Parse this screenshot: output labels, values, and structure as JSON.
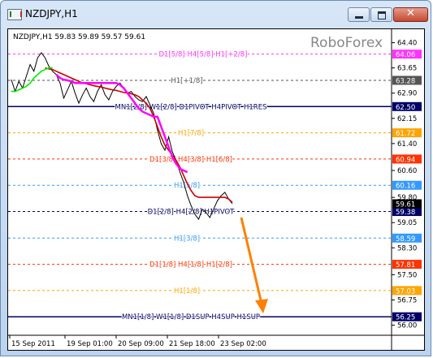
{
  "window": {
    "title": "NZDJPY,H1",
    "close_glyph": "✕",
    "icons": [
      "app-chart-icon",
      "minimize-icon",
      "maximize-icon",
      "close-icon"
    ]
  },
  "chart": {
    "info": "NZDJPY,H1  59.83 59.89 59.57 59.61",
    "watermark": "RoboForex"
  },
  "chart_data": {
    "type": "line",
    "symbol": "NZDJPY",
    "timeframe": "H1",
    "ohlc": {
      "open": 59.83,
      "high": 59.89,
      "low": 59.57,
      "close": 59.61
    },
    "ylim": [
      55.7,
      64.8
    ],
    "x_ticks": [
      "15 Sep 2011",
      "19 Sep 01:00",
      "20 Sep 09:00",
      "21 Sep 18:00",
      "23 Sep 02:00"
    ],
    "y_ticks": [
      "64.40",
      "63.65",
      "62.90",
      "62.15",
      "61.40",
      "60.60",
      "59.80",
      "59.05",
      "58.30",
      "57.50",
      "56.75",
      "56.00"
    ],
    "levels": [
      {
        "value": 64.06,
        "tag": "64.06",
        "label": "D1[5/8] H4[5/8] H1[+2/8]",
        "color": "#ff33ff",
        "tag_text": "#ffffff",
        "style": "dashed"
      },
      {
        "value": 63.28,
        "tag": "63.28",
        "label": "H1[+1/8]",
        "color": "#555555",
        "tag_text": "#ffffff",
        "style": "dashed"
      },
      {
        "value": 62.5,
        "tag": "62.50",
        "label": "MN1[2/8] W1[2/8] D1PIVOT H4PIVOT H1RES",
        "color": "#000066",
        "tag_text": "#ffffff",
        "style": "solid"
      },
      {
        "value": 61.72,
        "tag": "61.72",
        "label": "H1[7/8]",
        "color": "#ffa500",
        "tag_text": "#ffffff",
        "style": "dashed"
      },
      {
        "value": 60.94,
        "tag": "60.94",
        "label": "D1[3/8] H4[3/8] H1[6/8]",
        "color": "#ff3300",
        "tag_text": "#ffffff",
        "style": "dashed"
      },
      {
        "value": 60.16,
        "tag": "60.16",
        "label": "H1[5/8]",
        "color": "#3399ff",
        "tag_text": "#ffffff",
        "style": "dashed"
      },
      {
        "value": 59.38,
        "tag": "59.38",
        "label": "D1[2/8] H4[2/8] H1PIVOT",
        "color": "#000066",
        "tag_text": "#ffffff",
        "style": "dashed"
      },
      {
        "value": 58.59,
        "tag": "58.59",
        "label": "H1[3/8]",
        "color": "#3399ff",
        "tag_text": "#ffffff",
        "style": "dashed"
      },
      {
        "value": 57.81,
        "tag": "57.81",
        "label": "D1[1/8] H4[1/8] H1[2/8]",
        "color": "#ff3300",
        "tag_text": "#ffffff",
        "style": "dashed"
      },
      {
        "value": 57.03,
        "tag": "57.03",
        "label": "H1[1/8]",
        "color": "#ffa500",
        "tag_text": "#ffffff",
        "style": "dashed"
      },
      {
        "value": 56.25,
        "tag": "56.25",
        "label": "MN1[1/8] W1[1/8] D1SUP H4SUP H1SUP",
        "color": "#000066",
        "tag_text": "#ffffff",
        "style": "solid"
      }
    ],
    "current_price_tags": [
      {
        "value": 59.61,
        "tag": "59.61",
        "color": "#000000",
        "tag_text": "#ffffff"
      }
    ],
    "series": [
      {
        "color": "#000000",
        "values": [
          63.3,
          62.95,
          63.25,
          63.05,
          63.4,
          63.75,
          63.55,
          63.95,
          64.1,
          63.95,
          63.7,
          63.55,
          63.45,
          63.2,
          62.75,
          63.0,
          63.25,
          62.9,
          62.6,
          62.85,
          63.05,
          62.8,
          62.65,
          62.95,
          63.15,
          62.85,
          62.7,
          62.95,
          63.1,
          63.2,
          63.05,
          62.9,
          62.95,
          62.8,
          62.7,
          62.65,
          62.8,
          62.55,
          62.3,
          61.8,
          61.4,
          61.2,
          61.6,
          61.15,
          60.9,
          60.55,
          60.25,
          59.85,
          59.55,
          59.3,
          59.15,
          59.45,
          59.35,
          59.2,
          59.45,
          59.7,
          59.85,
          59.95,
          59.75,
          59.61
        ]
      },
      {
        "color": "#cc0000",
        "values": [
          null,
          null,
          null,
          null,
          null,
          null,
          null,
          null,
          null,
          63.65,
          63.62,
          63.6,
          63.55,
          63.5,
          63.45,
          63.4,
          63.35,
          63.3,
          63.25,
          63.2,
          63.18,
          63.15,
          63.12,
          63.1,
          63.08,
          63.05,
          63.02,
          63.0,
          62.98,
          62.95,
          62.92,
          62.9,
          62.88,
          62.85,
          62.8,
          62.7,
          62.6,
          62.45,
          62.2,
          61.9,
          61.6,
          61.35,
          61.2,
          61.05,
          60.9,
          60.7,
          60.45,
          60.2,
          60.0,
          59.85,
          59.8,
          59.8,
          59.8,
          59.8,
          59.8,
          59.8,
          59.8,
          59.8,
          59.75,
          59.65
        ]
      },
      {
        "color": "#00ee00",
        "values": [
          62.95,
          62.95,
          63.0,
          63.05,
          63.1,
          63.2,
          63.35,
          63.45,
          63.55,
          63.6,
          63.65,
          63.65,
          null,
          null,
          null,
          null,
          null,
          null,
          null,
          null,
          null,
          null,
          null,
          null,
          null,
          null,
          null,
          null,
          null,
          null,
          null,
          null,
          null,
          null,
          null,
          null,
          null,
          null,
          null,
          null,
          null,
          null,
          null,
          null,
          null,
          null,
          null,
          null,
          null,
          null,
          null,
          null,
          null,
          null,
          null,
          null,
          null,
          null,
          null,
          null
        ]
      },
      {
        "color": "#ff00ff",
        "values": [
          null,
          null,
          null,
          null,
          null,
          null,
          null,
          null,
          null,
          null,
          null,
          null,
          63.45,
          63.35,
          63.3,
          63.28,
          63.25,
          63.2,
          63.2,
          63.2,
          63.2,
          63.2,
          63.2,
          63.2,
          63.2,
          63.2,
          63.2,
          63.2,
          63.2,
          63.15,
          63.05,
          62.9,
          62.75,
          62.6,
          62.45,
          62.35,
          62.3,
          62.25,
          62.2,
          62.2,
          61.9,
          61.6,
          61.3,
          61.0,
          60.8,
          60.65,
          60.6,
          60.55,
          null,
          null,
          null,
          null,
          null,
          null,
          null,
          null,
          null,
          null,
          null,
          null
        ]
      }
    ],
    "arrow": {
      "color": "#ff8000",
      "from": 59.2,
      "to": 56.35
    }
  }
}
